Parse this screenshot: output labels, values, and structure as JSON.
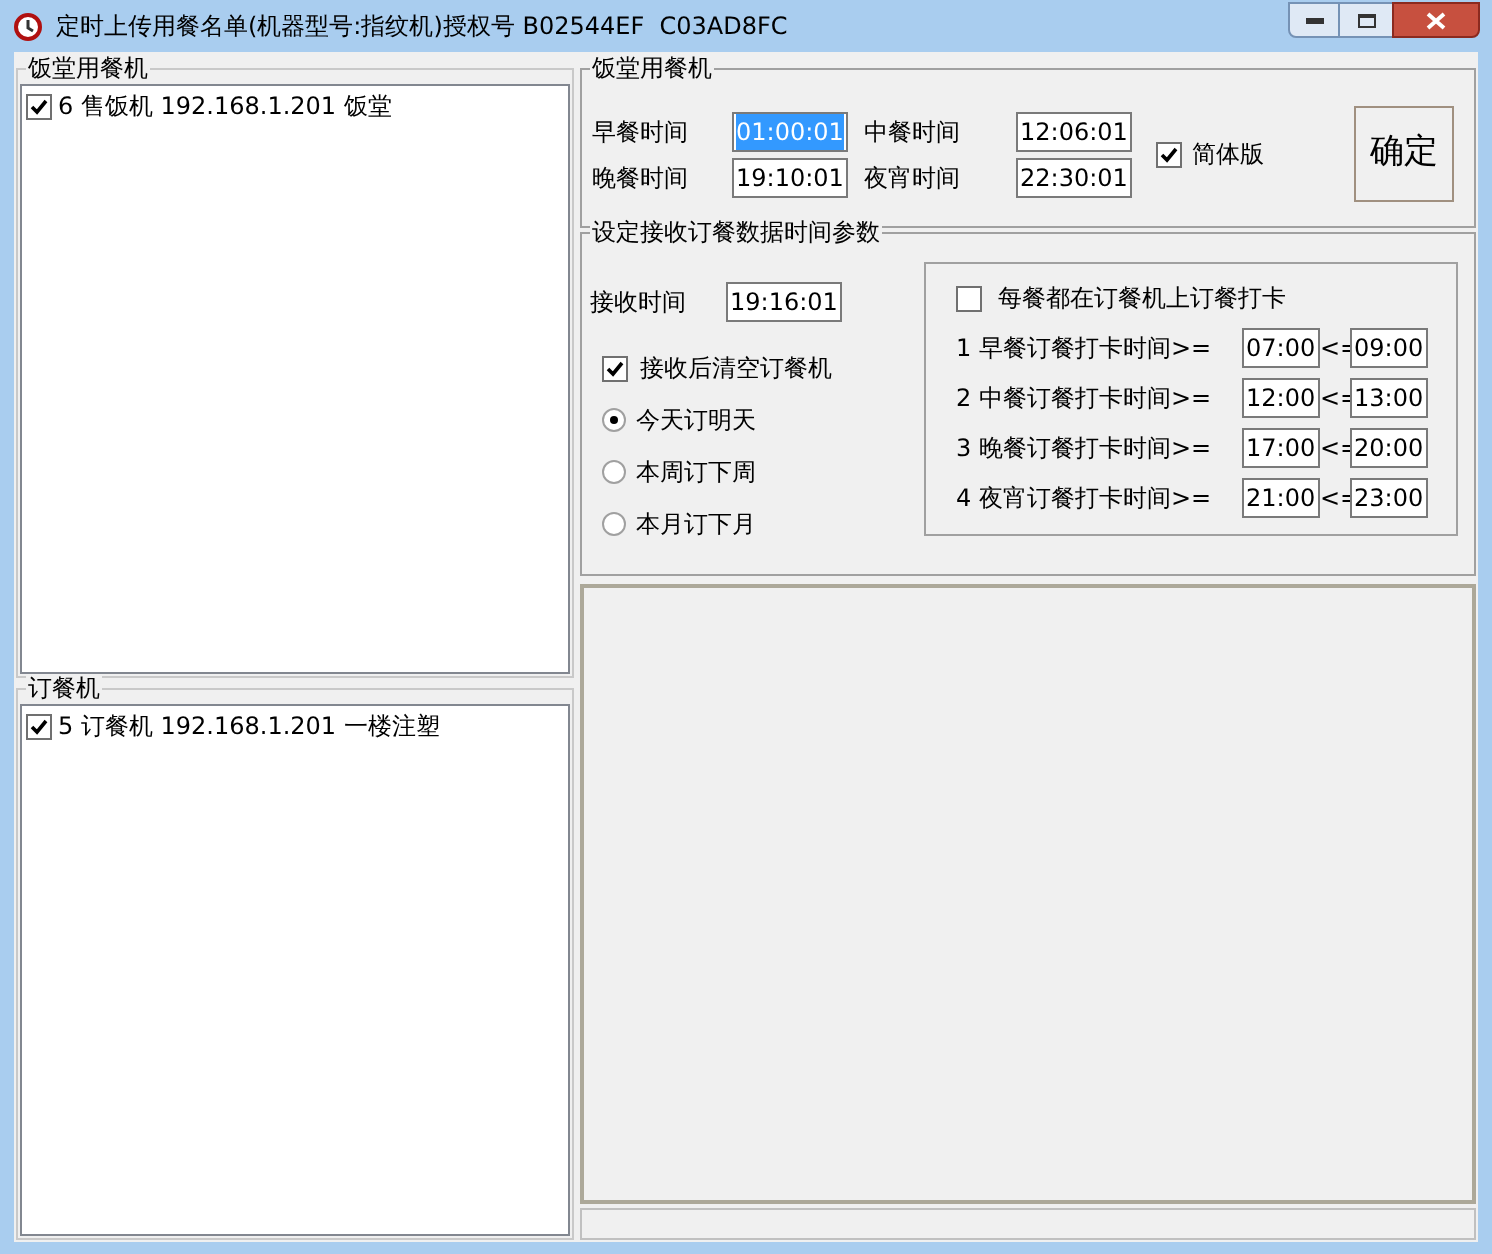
{
  "window": {
    "title": "定时上传用餐名单(机器型号:指纹机)授权号 B02544EF  C03AD8FC"
  },
  "canteen_machines": {
    "title": "饭堂用餐机",
    "items": [
      {
        "text": "6  售饭机 192.168.1.201 饭堂",
        "checked": true
      }
    ]
  },
  "order_machines": {
    "title": "订餐机",
    "items": [
      {
        "text": "5  订餐机 192.168.1.201 一楼注塑",
        "checked": true
      }
    ]
  },
  "canteen_settings": {
    "title": "饭堂用餐机",
    "fields": [
      {
        "label": "早餐时间",
        "value": "01:00:01",
        "selected": true
      },
      {
        "label": "中餐时间",
        "value": "12:06:01",
        "selected": false
      },
      {
        "label": "晚餐时间",
        "value": "19:10:01",
        "selected": false
      },
      {
        "label": "夜宵时间",
        "value": "22:30:01",
        "selected": false
      }
    ],
    "simplified": {
      "label": "简体版",
      "checked": true
    },
    "confirm_button": "确定"
  },
  "receive_settings": {
    "title": "设定接收订餐数据时间参数",
    "receive_time": {
      "label": "接收时间",
      "value": "19:16:01"
    },
    "clear_after": {
      "label": "接收后清空订餐机",
      "checked": true
    },
    "modes": [
      {
        "label": "今天订明天",
        "selected": true
      },
      {
        "label": "本周订下周",
        "selected": false
      },
      {
        "label": "本月订下月",
        "selected": false
      }
    ],
    "punch": {
      "every_meal": {
        "label": "每餐都在订餐机上订餐打卡",
        "checked": false
      },
      "rows": [
        {
          "label": "1 早餐订餐打卡时间>=",
          "from": "07:00",
          "separator": "<=",
          "to": "09:00"
        },
        {
          "label": "2 中餐订餐打卡时间>=",
          "from": "12:00",
          "separator": "<=",
          "to": "13:00"
        },
        {
          "label": "3 晚餐订餐打卡时间>=",
          "from": "17:00",
          "separator": "<=",
          "to": "20:00"
        },
        {
          "label": "4 夜宵订餐打卡时间>=",
          "from": "21:00",
          "separator": "<=",
          "to": "23:00"
        }
      ]
    }
  }
}
